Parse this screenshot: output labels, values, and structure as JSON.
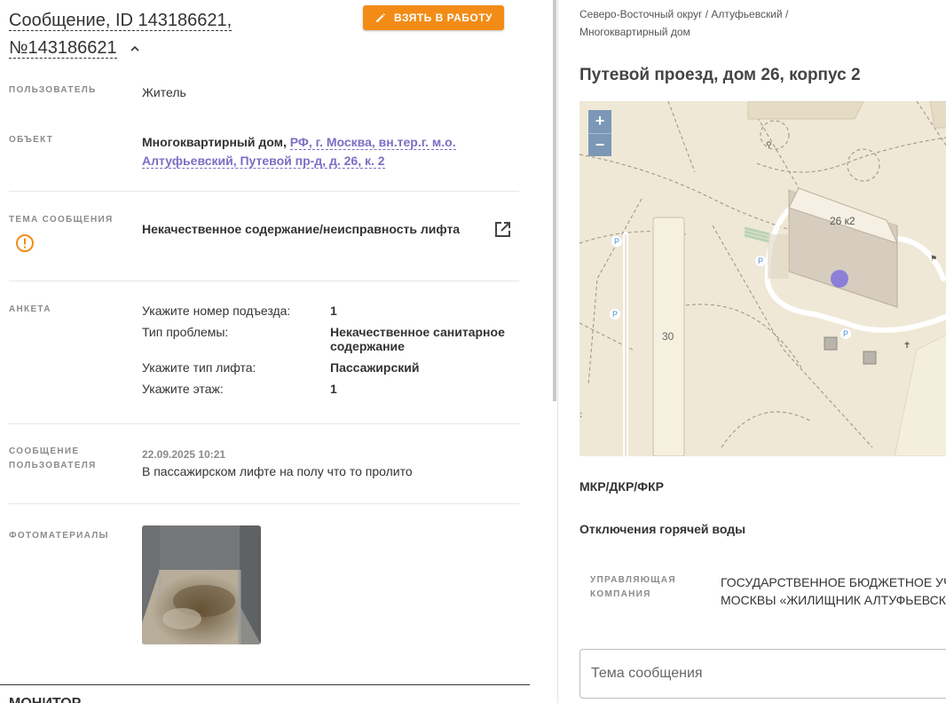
{
  "message": {
    "title_line1": "Сообщение, ID 143186621,",
    "title_line2": "№143186621",
    "take_button": "ВЗЯТЬ В РАБОТУ",
    "user_label": "ПОЛЬЗОВАТЕЛЬ",
    "user_value": "Житель",
    "object_label": "ОБЪЕКТ",
    "object_type": "Многоквартирный дом,",
    "object_address_line1": "РФ, г. Москва, вн.тер.г. м.о.",
    "object_address_line2": "Алтуфьевский, Путевой пр-д, д. 26, к. 2",
    "topic_label": "ТЕМА СООБЩЕНИЯ",
    "topic_value": "Некачественное содержание/неисправность лифта",
    "survey_label": "АНКЕТА",
    "survey": [
      {
        "q": "Укажите номер подъезда:",
        "a": "1"
      },
      {
        "q": "Тип проблемы:",
        "a": "Некачественное санитарное содержание"
      },
      {
        "q": "Укажите тип лифта:",
        "a": "Пассажирский"
      },
      {
        "q": "Укажите этаж:",
        "a": "1"
      }
    ],
    "user_msg_label_line1": "СООБЩЕНИЕ",
    "user_msg_label_line2": "ПОЛЬЗОВАТЕЛЯ",
    "user_msg_date": "22.09.2025 10:21",
    "user_msg_text": "В пассажирском лифте на полу что то пролито",
    "photos_label": "ФОТОМАТЕРИАЛЫ",
    "next_section_partial": "МОНИТОР"
  },
  "location": {
    "breadcrumb_line1": "Северо-Восточный округ / Алтуфьевский /",
    "breadcrumb_line2": "Многоквартирный дом",
    "address": "Путевой проезд, дом 26, корпус 2",
    "map": {
      "zoom_in": "+",
      "zoom_out": "−",
      "building_label": "26 к2",
      "building_30_label": "30",
      "parking_label": "P"
    },
    "section_mkr": "МКР/ДКР/ФКР",
    "section_hot_water": "Отключения горячей воды",
    "mgmt_label_line1": "УПРАВЛЯЮЩАЯ",
    "mgmt_label_line2": "КОМПАНИЯ",
    "mgmt_value_line1": "ГОСУДАРСТВЕННОЕ БЮДЖЕТНОЕ УЧРЕ",
    "mgmt_value_line2": "МОСКВЫ «ЖИЛИЩНИК АЛТУФЬЕВСКОГ",
    "theme_placeholder": "Тема сообщения"
  },
  "colors": {
    "accent_orange": "#f28c16",
    "link_purple": "#7a6fc4",
    "warning_orange": "#f28c16",
    "map_marker": "#8b7fd8"
  }
}
